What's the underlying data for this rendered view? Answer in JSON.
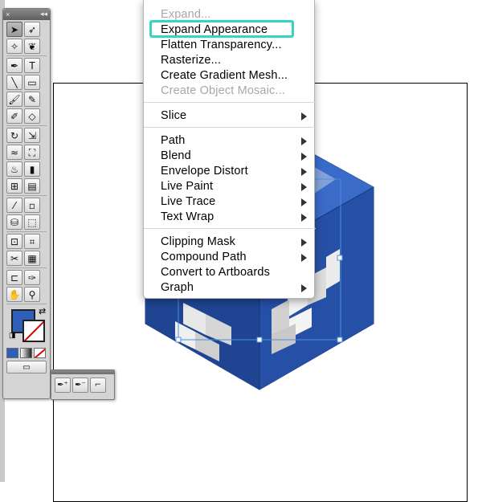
{
  "context_menu": {
    "items": [
      {
        "label": "Expand...",
        "disabled": true,
        "submenu": false
      },
      {
        "label": "Expand Appearance",
        "disabled": false,
        "submenu": false,
        "highlighted": true
      },
      {
        "label": "Flatten Transparency...",
        "disabled": false,
        "submenu": false
      },
      {
        "label": "Rasterize...",
        "disabled": false,
        "submenu": false
      },
      {
        "label": "Create Gradient Mesh...",
        "disabled": false,
        "submenu": false
      },
      {
        "label": "Create Object Mosaic...",
        "disabled": true,
        "submenu": false
      },
      {
        "label": "Slice",
        "disabled": false,
        "submenu": true
      },
      {
        "label": "Path",
        "disabled": false,
        "submenu": true
      },
      {
        "label": "Blend",
        "disabled": false,
        "submenu": true
      },
      {
        "label": "Envelope Distort",
        "disabled": false,
        "submenu": true
      },
      {
        "label": "Live Paint",
        "disabled": false,
        "submenu": true
      },
      {
        "label": "Live Trace",
        "disabled": false,
        "submenu": true
      },
      {
        "label": "Text Wrap",
        "disabled": false,
        "submenu": true
      },
      {
        "label": "Clipping Mask",
        "disabled": false,
        "submenu": true
      },
      {
        "label": "Compound Path",
        "disabled": false,
        "submenu": true
      },
      {
        "label": "Convert to Artboards",
        "disabled": false,
        "submenu": false
      },
      {
        "label": "Graph",
        "disabled": false,
        "submenu": true
      }
    ]
  },
  "tools_panel": {
    "close_glyph": "×",
    "collapse_glyph": "◂◂",
    "groups": [
      [
        [
          "selection-tool",
          "➤"
        ],
        [
          "direct-selection-tool",
          "➶"
        ]
      ],
      [
        [
          "magic-wand-tool",
          "✧"
        ],
        [
          "lasso-tool",
          "❦"
        ]
      ],
      [
        [
          "pen-tool",
          "✒"
        ],
        [
          "type-tool",
          "T"
        ]
      ],
      [
        [
          "line-segment-tool",
          "╲"
        ],
        [
          "rectangle-tool",
          "▭"
        ]
      ],
      [
        [
          "paintbrush-tool",
          "🖌"
        ],
        [
          "pencil-tool",
          "✎"
        ]
      ],
      [
        [
          "blob-brush-tool",
          "✐"
        ],
        [
          "eraser-tool",
          "◇"
        ]
      ],
      [
        [
          "rotate-tool",
          "↻"
        ],
        [
          "scale-tool",
          "⇲"
        ]
      ],
      [
        [
          "warp-tool",
          "≈"
        ],
        [
          "free-transform-tool",
          "⛶"
        ]
      ],
      [
        [
          "symbol-sprayer-tool",
          "♨"
        ],
        [
          "column-graph-tool",
          "▮"
        ]
      ],
      [
        [
          "mesh-tool",
          "⊞"
        ],
        [
          "gradient-tool",
          "▤"
        ]
      ],
      [
        [
          "eyedropper-tool",
          "⁄"
        ],
        [
          "blend-tool",
          "▫"
        ]
      ],
      [
        [
          "live-paint-bucket-tool",
          "⛁"
        ],
        [
          "live-paint-selection-tool",
          "⬚"
        ]
      ],
      [
        [
          "artboard-tool",
          "⊡"
        ],
        [
          "slice-tool",
          "⌗"
        ]
      ],
      [
        [
          "scissors-tool",
          "✂"
        ],
        [
          "measure-tool",
          "▦"
        ]
      ],
      [
        [
          "crop-area-tool",
          "⊏"
        ],
        [
          "knife-tool",
          "✑"
        ]
      ],
      [
        [
          "hand-tool",
          "✋"
        ],
        [
          "zoom-tool",
          "⚲"
        ]
      ]
    ],
    "swap_glyph": "⇄",
    "default_glyph": "◨",
    "screen_mode_glyph": "▭"
  },
  "pen_flyout": {
    "tools": [
      [
        "add-anchor-point-tool",
        "✒⁺"
      ],
      [
        "delete-anchor-point-tool",
        "✒⁻"
      ],
      [
        "convert-anchor-point-tool",
        "⌐"
      ]
    ]
  },
  "colors": {
    "fill": "#2f5fb8",
    "highlight": "#35d6c1",
    "cube_dark": "#1f3f8f",
    "cube_mid": "#2f5fb8",
    "cube_light": "#4a78d0"
  }
}
